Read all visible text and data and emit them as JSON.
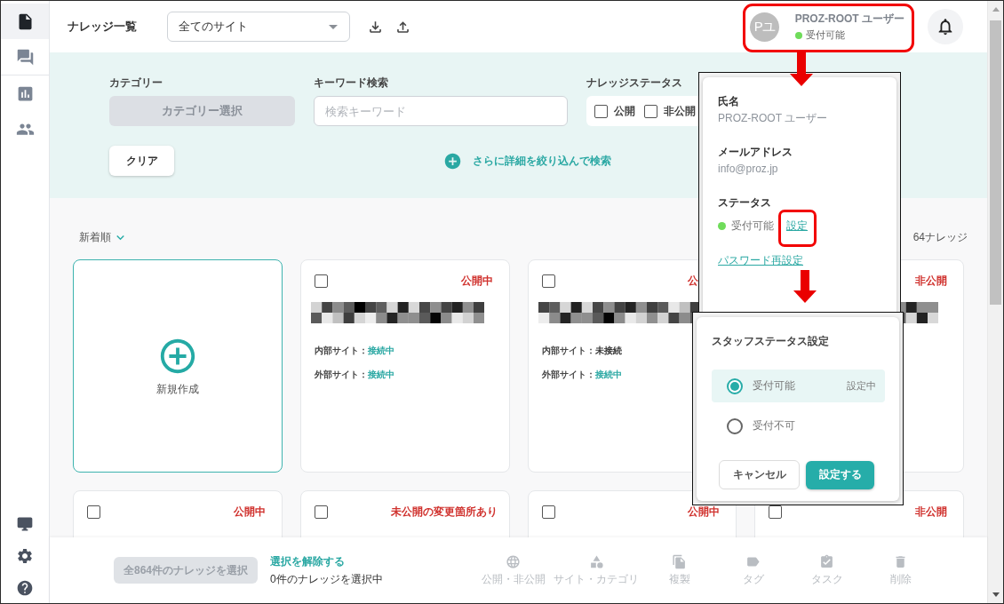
{
  "sidebar": {
    "items": [
      {
        "selected": true
      },
      {
        "selected": false
      },
      {
        "selected": false
      },
      {
        "selected": false
      }
    ]
  },
  "header": {
    "title": "ナレッジ一覧",
    "site_select": {
      "value": "全てのサイト"
    },
    "user": {
      "avatar": "Pユ",
      "name": "PROZ-ROOT ユーザー",
      "status": "受付可能",
      "available": true
    }
  },
  "filters": {
    "category": {
      "label": "カテゴリー",
      "button": "カテゴリー選択"
    },
    "keyword": {
      "label": "キーワード検索",
      "placeholder": "検索キーワード"
    },
    "status": {
      "label": "ナレッジステータス",
      "options": [
        {
          "label": "公開",
          "checked": false
        },
        {
          "label": "非公開",
          "checked": false
        }
      ]
    },
    "clear_button": "クリア",
    "advanced_link": "さらに詳細を絞り込んで検索"
  },
  "list": {
    "sort": "新着順",
    "count": "64ナレッジ",
    "new_card": {
      "label": "新規作成"
    },
    "cards": [
      {
        "checked": false,
        "status": "公開中",
        "redacted_title": true,
        "sites": [
          {
            "label": "内部サイト：",
            "value": "接続中",
            "connected": true
          },
          {
            "label": "外部サイト：",
            "value": "接続中",
            "connected": true
          }
        ]
      },
      {
        "checked": false,
        "status": "公",
        "redacted_title": true,
        "sites": [
          {
            "label": "内部サイト：",
            "value": "未接続",
            "connected": false
          },
          {
            "label": "外部サイト：",
            "value": "接続中",
            "connected": true
          }
        ]
      },
      {
        "status": "非公開",
        "redacted_title": true
      },
      {
        "checked": false,
        "status": "公開中"
      },
      {
        "checked": false,
        "status": "未公開の変更箇所あり"
      },
      {
        "checked": false,
        "status": "公開中"
      },
      {
        "checked": false,
        "status": "非公開"
      }
    ]
  },
  "bottom_bar": {
    "select_all_button": {
      "label": "全864件のナレッジを選択",
      "disabled": true
    },
    "deselect_link": "選択を解除する",
    "selection_count": "0件のナレッジを選択中",
    "actions": [
      {
        "label": "公開・非公開",
        "disabled": true
      },
      {
        "label": "サイト・カテゴリ",
        "disabled": true
      },
      {
        "label": "複製",
        "disabled": true
      },
      {
        "label": "タグ",
        "disabled": true
      },
      {
        "label": "タスク",
        "disabled": true
      },
      {
        "label": "削除",
        "disabled": true
      }
    ]
  },
  "profile_popover": {
    "fields": [
      {
        "label": "氏名",
        "value": "PROZ-ROOT ユーザー"
      },
      {
        "label": "メールアドレス",
        "value": "info@proz.jp"
      }
    ],
    "status": {
      "label": "ステータス",
      "value": "受付可能",
      "available": true,
      "link": "設定"
    },
    "password_link": "パスワード再設定"
  },
  "status_dialog": {
    "title": "スタッフステータス設定",
    "options": [
      {
        "label": "受付可能",
        "selected": true,
        "badge": "設定中"
      },
      {
        "label": "受付不可",
        "selected": false
      }
    ],
    "buttons": [
      {
        "label": "キャンセル",
        "kind": "secondary"
      },
      {
        "label": "設定する",
        "kind": "primary"
      }
    ]
  }
}
